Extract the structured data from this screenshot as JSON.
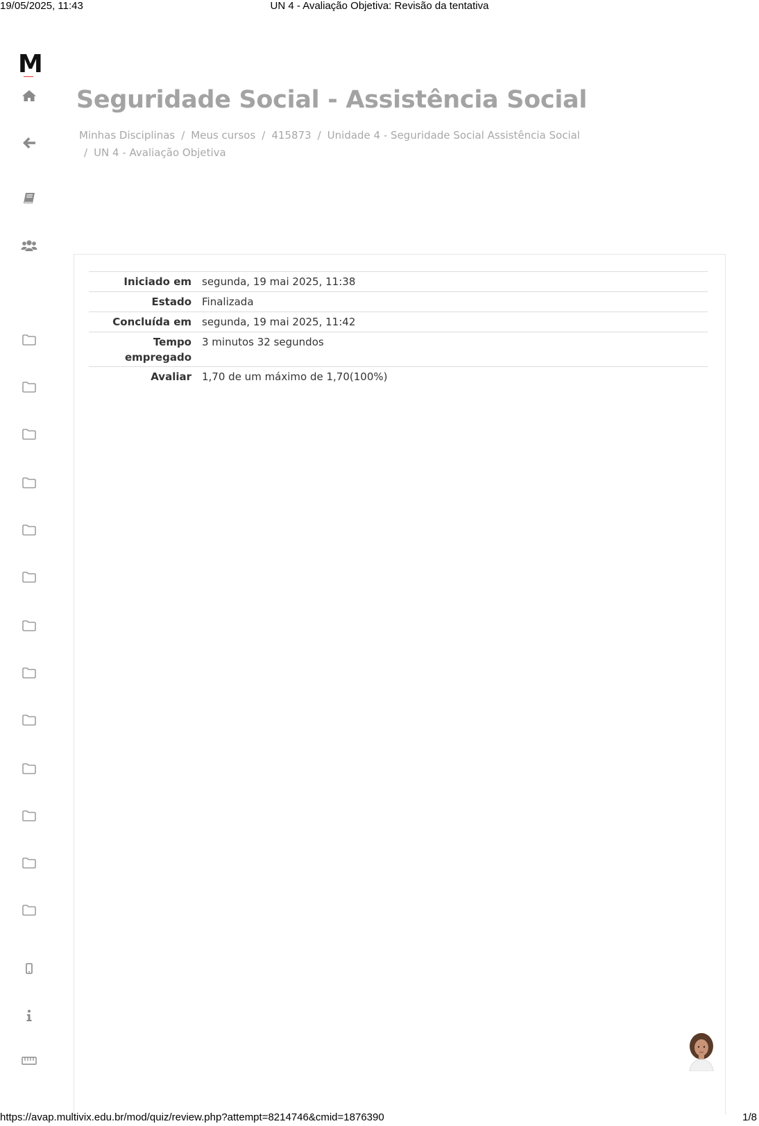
{
  "print": {
    "datetime": "19/05/2025, 11:43",
    "doc_title": "UN 4 - Avaliação Objetiva: Revisão da tentativa",
    "url": "https://avap.multivix.edu.br/mod/quiz/review.php?attempt=8214746&cmid=1876390",
    "page": "1/8"
  },
  "logo": {
    "text": "M"
  },
  "sidebar": {
    "icons": [
      "home-icon",
      "back-arrow-icon",
      "book-icon",
      "users-icon",
      "folder-icon",
      "folder-icon",
      "folder-icon",
      "folder-icon",
      "folder-icon",
      "folder-icon",
      "folder-icon",
      "folder-icon",
      "folder-icon",
      "folder-icon",
      "folder-icon",
      "folder-icon",
      "folder-icon",
      "mobile-icon",
      "info-icon",
      "keyboard-icon"
    ]
  },
  "page_title": "Seguridade Social - Assistência Social",
  "breadcrumb": {
    "items": [
      "Minhas Disciplinas",
      "Meus cursos",
      "415873",
      "Unidade 4 - Seguridade Social Assistência Social",
      "UN 4 - Avaliação Objetiva"
    ],
    "separator": "/"
  },
  "summary": {
    "rows": [
      {
        "label": "Iniciado em",
        "value": "segunda, 19 mai 2025, 11:38"
      },
      {
        "label": "Estado",
        "value": "Finalizada"
      },
      {
        "label": "Concluída em",
        "value": "segunda, 19 mai 2025, 11:42"
      },
      {
        "label": "Tempo empregado",
        "value": "3 minutos 32 segundos"
      },
      {
        "label": "Avaliar",
        "value": "1,70 de um máximo de 1,70(100%)"
      }
    ]
  },
  "colors": {
    "title": "#a3a3a3",
    "icon": "#888888",
    "text": "#333333"
  }
}
